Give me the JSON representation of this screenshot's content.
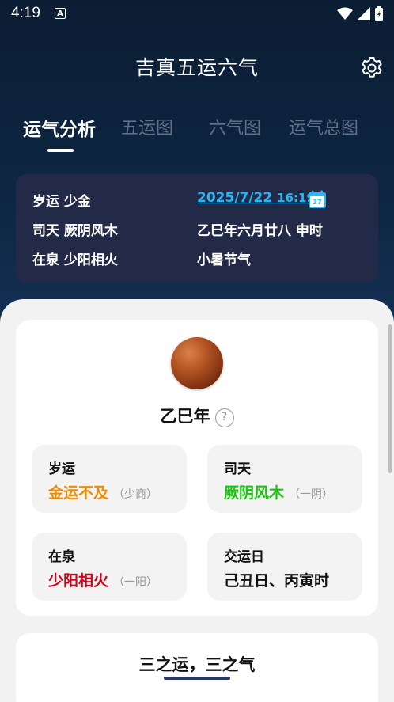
{
  "status": {
    "time": "4:19",
    "a_icon": "A"
  },
  "app": {
    "title": "吉真五运六气"
  },
  "tabs": [
    {
      "label": "运气分析",
      "active": true
    },
    {
      "label": "五运图"
    },
    {
      "label": "六气图"
    },
    {
      "label": "运气总图"
    }
  ],
  "info": {
    "suiyun": "岁运 少金",
    "sitian": "司天 厥阴风木",
    "zaiquan": "在泉 少阳相火",
    "date": "2025/7/22",
    "time": "16:19",
    "calendar_day": "37",
    "lunar": "乙巳年六月廿八 申时",
    "jieqi": "小暑节气"
  },
  "card": {
    "year": "乙巳年",
    "help": "?",
    "tiles": [
      {
        "label": "岁运",
        "value": "金运不及",
        "sub": "（少商）",
        "color": "#f08c00"
      },
      {
        "label": "司天",
        "value": "厥阴风木",
        "sub": "（一阴）",
        "color": "#16c60c"
      },
      {
        "label": "在泉",
        "value": "少阳相火",
        "sub": "（一阳）",
        "color": "#d0021b"
      },
      {
        "label": "交运日",
        "value": "己丑日、丙寅时",
        "sub": "",
        "color": "#111111"
      }
    ]
  },
  "section2": {
    "title": "三之运，三之气"
  }
}
